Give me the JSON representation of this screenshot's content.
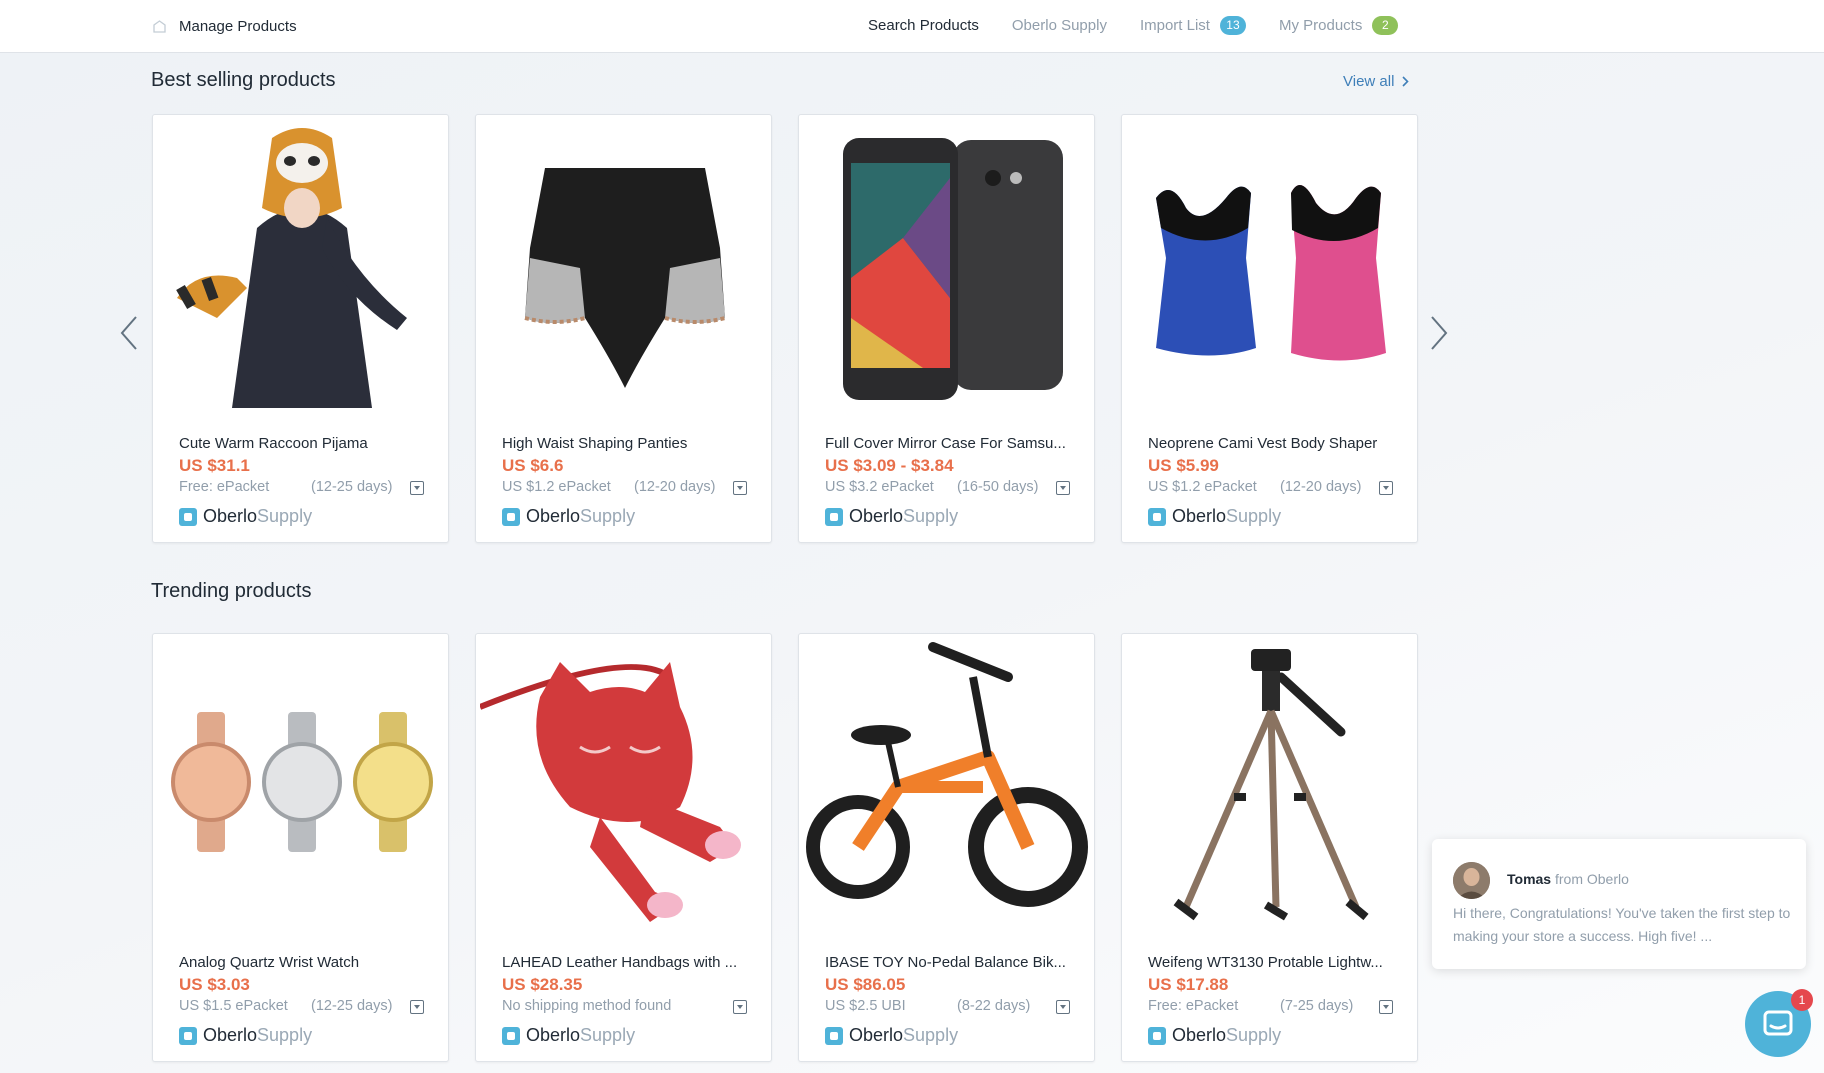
{
  "topbar": {
    "brand_label": "Manage Products",
    "nav": [
      {
        "label": "Search Products",
        "active": true
      },
      {
        "label": "Oberlo Supply"
      },
      {
        "label": "Import List",
        "badge": "13"
      },
      {
        "label": "My Products",
        "badge": "2"
      }
    ]
  },
  "best_selling": {
    "title": "Best selling products",
    "view_all": "View all",
    "products": [
      {
        "name": "Cute Warm Raccoon Pijama",
        "price": "US $31.1",
        "shipping": "Free: ePacket",
        "days": "(12-25 days)",
        "supply_a": "Oberlo",
        "supply_b": "Supply"
      },
      {
        "name": "High Waist Shaping Panties",
        "price": "US $6.6",
        "shipping": "US $1.2 ePacket",
        "days": "(12-20 days)",
        "supply_a": "Oberlo",
        "supply_b": "Supply"
      },
      {
        "name": "Full Cover Mirror Case For Samsu...",
        "price": "US $3.09 - $3.84",
        "shipping": "US $3.2 ePacket",
        "days": "(16-50 days)",
        "supply_a": "Oberlo",
        "supply_b": "Supply"
      },
      {
        "name": "Neoprene Cami Vest Body Shaper",
        "price": "US $5.99",
        "shipping": "US $1.2 ePacket",
        "days": "(12-20 days)",
        "supply_a": "Oberlo",
        "supply_b": "Supply"
      }
    ]
  },
  "trending": {
    "title": "Trending products",
    "products": [
      {
        "name": "Analog Quartz Wrist Watch",
        "price": "US $3.03",
        "shipping": "US $1.5 ePacket",
        "days": "(12-25 days)",
        "supply_a": "Oberlo",
        "supply_b": "Supply"
      },
      {
        "name": "LAHEAD Leather Handbags with ...",
        "price": "US $28.35",
        "shipping": "No shipping method found",
        "days": "",
        "supply_a": "Oberlo",
        "supply_b": "Supply"
      },
      {
        "name": "IBASE TOY No-Pedal Balance Bik...",
        "price": "US $86.05",
        "shipping": "US $2.5 UBI",
        "days": "(8-22 days)",
        "supply_a": "Oberlo",
        "supply_b": "Supply"
      },
      {
        "name": "Weifeng WT3130 Protable Lightw...",
        "price": "US $17.88",
        "shipping": "Free: ePacket",
        "days": "(7-25 days)",
        "supply_a": "Oberlo",
        "supply_b": "Supply"
      }
    ]
  },
  "chat": {
    "sender": "Tomas",
    "from_text": "from Oberlo",
    "message": "Hi there, Congratulations! You've taken the first step to making your store a success. High five! ...",
    "unread": "1"
  },
  "colors": {
    "accent": "#4fb3d9",
    "price": "#e8704b",
    "link": "#3f7fb8",
    "badge_green": "#8fc15a"
  }
}
